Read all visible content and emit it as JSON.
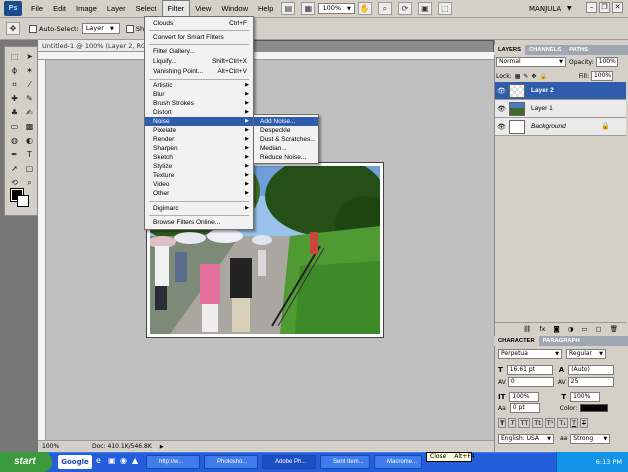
{
  "menubar": {
    "logo": "Ps",
    "items": [
      "File",
      "Edit",
      "Image",
      "Layer",
      "Select",
      "Filter",
      "View",
      "Window",
      "Help"
    ],
    "zoom": "100%",
    "workspace": "MANJULA"
  },
  "options": {
    "auto_select_label": "Auto-Select:",
    "auto_select_value": "Layer",
    "show_label": "Sho"
  },
  "document": {
    "title": "Untitled-1 @ 100% (Layer 2, RGB/",
    "zoom": "100%",
    "doc_info": "Doc: 410.1K/546.8K"
  },
  "filter_menu": {
    "items": [
      {
        "label": "Clouds",
        "shortcut": "Ctrl+F"
      },
      {
        "label": "Convert for Smart Filters"
      },
      {
        "label": "Filter Gallery..."
      },
      {
        "label": "Liquify...",
        "shortcut": "Shift+Ctrl+X"
      },
      {
        "label": "Vanishing Point...",
        "shortcut": "Alt+Ctrl+V"
      },
      {
        "label": "Artistic"
      },
      {
        "label": "Blur"
      },
      {
        "label": "Brush Strokes"
      },
      {
        "label": "Distort"
      },
      {
        "label": "Noise"
      },
      {
        "label": "Pixelate"
      },
      {
        "label": "Render"
      },
      {
        "label": "Sharpen"
      },
      {
        "label": "Sketch"
      },
      {
        "label": "Stylize"
      },
      {
        "label": "Texture"
      },
      {
        "label": "Video"
      },
      {
        "label": "Other"
      },
      {
        "label": "Digimarc"
      },
      {
        "label": "Browse Filters Online..."
      }
    ],
    "submenu": [
      "Add Noise...",
      "Despeckle",
      "Dust & Scratches...",
      "Median...",
      "Reduce Noise..."
    ]
  },
  "layers_panel": {
    "tabs": [
      "LAYERS",
      "CHANNELS",
      "PATHS"
    ],
    "blend_mode": "Normal",
    "opacity_label": "Opacity:",
    "opacity": "100%",
    "lock_label": "Lock:",
    "fill_label": "Fill:",
    "fill": "100%",
    "layers": [
      "Layer 2",
      "Layer 1",
      "Background"
    ]
  },
  "character_panel": {
    "tabs": [
      "CHARACTER",
      "PARAGRAPH"
    ],
    "font": "Perpetua",
    "style": "Regular",
    "size": "16.61 pt",
    "leading": "(Auto)",
    "kerning": "0",
    "tracking": "25",
    "vscale": "100%",
    "hscale": "100%",
    "baseline": "0 pt",
    "color_label": "Color:",
    "language": "English: USA",
    "aa": "Strong"
  },
  "taskbar": {
    "start": "start",
    "google": "Google",
    "tasks": [
      "http://w...",
      "Photosho...",
      "Adobe Ph...",
      "Sent Item...",
      "Macrome...",
      "Close"
    ],
    "time": "6:13 PM",
    "tooltip": "Alt+F4"
  }
}
